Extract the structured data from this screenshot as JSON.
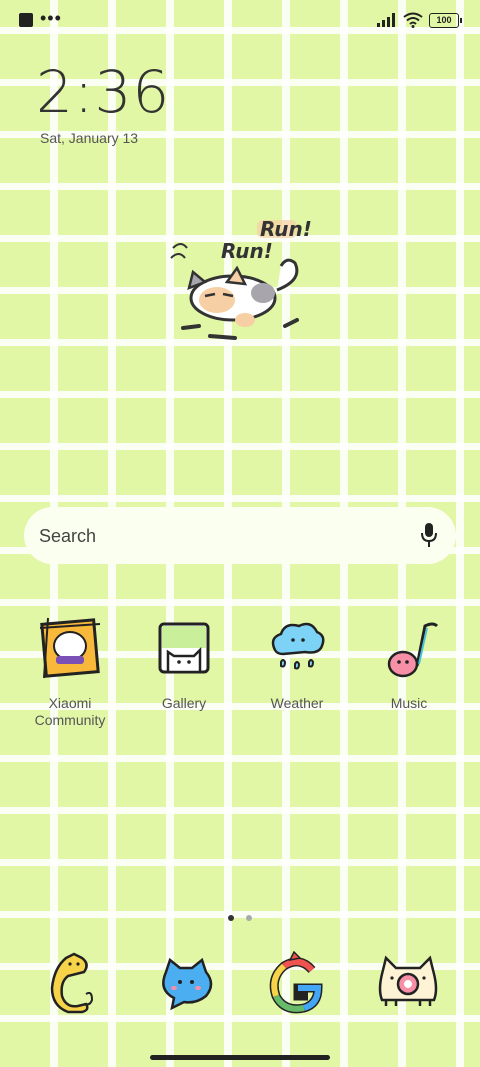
{
  "status_bar": {
    "battery": "100"
  },
  "clock": {
    "time": "2:36",
    "date": "Sat, January 13"
  },
  "widget": {
    "text1": "Run!",
    "text2": "Run!"
  },
  "search": {
    "placeholder": "Search"
  },
  "apps": [
    {
      "label": "Xiaomi Community",
      "icon": "xiaomi-community-icon"
    },
    {
      "label": "Gallery",
      "icon": "gallery-cat-icon"
    },
    {
      "label": "Weather",
      "icon": "weather-cloud-icon"
    },
    {
      "label": "Music",
      "icon": "music-note-icon"
    }
  ],
  "dock": [
    {
      "icon": "phone-cat-icon"
    },
    {
      "icon": "messages-cat-icon"
    },
    {
      "icon": "google-cat-icon"
    },
    {
      "icon": "camera-cat-icon"
    }
  ],
  "pager": {
    "pages": 2,
    "current": 1
  },
  "colors": {
    "background": "#e2f7a6",
    "grid": "#ffffff",
    "text": "#555555"
  }
}
